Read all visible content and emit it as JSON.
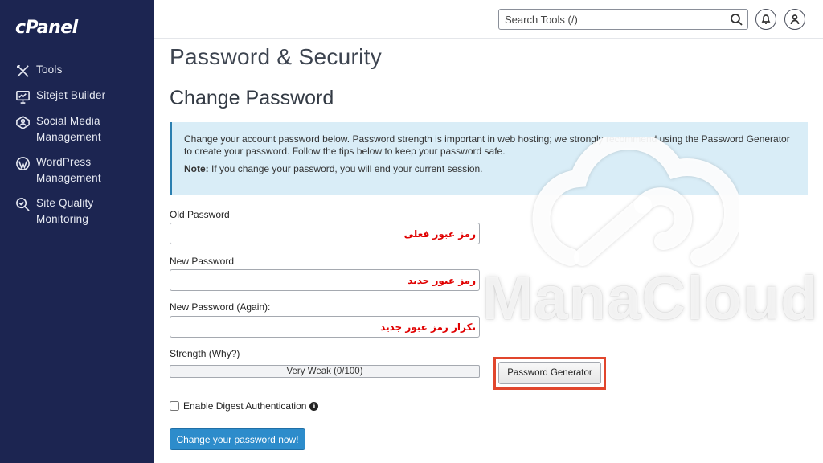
{
  "sidebar": {
    "logo": "cPanel",
    "items": [
      {
        "label": "Tools",
        "icon": "tools-icon"
      },
      {
        "label": "Sitejet Builder",
        "icon": "monitor-icon"
      },
      {
        "label": "Social Media\nManagement",
        "icon": "social-icon"
      },
      {
        "label": "WordPress\nManagement",
        "icon": "wordpress-icon"
      },
      {
        "label": "Site Quality\nMonitoring",
        "icon": "magnifier-icon"
      }
    ]
  },
  "header": {
    "search_placeholder": "Search Tools (/)"
  },
  "main": {
    "page_title": "Password & Security",
    "section_title": "Change Password",
    "info_text": "Change your account password below. Password strength is important in web hosting; we strongly recommend using the Password Generator to create your password. Follow the tips below to keep your password safe.",
    "note_label": "Note:",
    "note_text": " If you change your password, you will end your current session.",
    "old_password_label": "Old Password",
    "old_password_placeholder": "رمز عبور فعلی",
    "new_password_label": "New Password",
    "new_password_placeholder": "رمز عبور جدید",
    "new_password_again_label": "New Password (Again):",
    "new_password_again_placeholder": "تکرار رمز عبور جدید",
    "strength_label": "Strength (Why?)",
    "strength_text": "Very Weak (0/100)",
    "strength_value": 0,
    "generator_label": "Password Generator",
    "digest_label": "Enable Digest Authentication",
    "submit_label": "Change your password now!"
  },
  "watermark": {
    "text": "ManaCloud"
  },
  "colors": {
    "sidebar_bg": "#1c2551",
    "info_bg": "#d9edf7",
    "primary_button": "#2d8ccb",
    "highlight": "#e1462d",
    "placeholder_red": "#e00000"
  }
}
